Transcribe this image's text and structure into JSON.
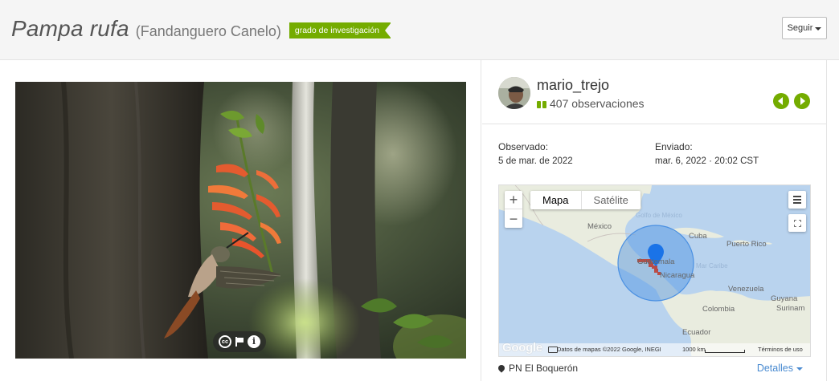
{
  "header": {
    "scientific_name": "Pampa rufa",
    "common_name": "(Fandanguero Canelo)",
    "quality_badge": "grado de investigación",
    "follow_label": "Seguir"
  },
  "photo": {
    "controls": [
      "cc-icon",
      "flag-icon",
      "info-icon"
    ],
    "cc_text": "cc"
  },
  "user": {
    "username": "mario_trejo",
    "observations": "407 observaciones"
  },
  "dates": {
    "observed_label": "Observado:",
    "observed_value": "5 de mar. de 2022",
    "submitted_label": "Enviado:",
    "submitted_value": "mar. 6, 2022 · 20:02 CST"
  },
  "map": {
    "type_options": [
      "Mapa",
      "Satélite"
    ],
    "selected_type": "Mapa",
    "labels": {
      "mexico": "México",
      "golfo": "Golfo de México",
      "cuba": "Cuba",
      "puerto_rico": "Puerto Rico",
      "guatemala": "Guatemala",
      "mar_caribe": "Mar Caribe",
      "nicaragua": "Nicaragua",
      "venezuela": "Venezuela",
      "guyana": "Guyana",
      "colombia": "Colombia",
      "surinam": "Surinam",
      "ecuador": "Ecuador"
    },
    "footer": {
      "google": "Google",
      "attribution": "Datos de mapas ©2022 Google, INEGI",
      "scale": "1000 km",
      "terms": "Términos de uso"
    },
    "colors": {
      "water": "#b9d3ee",
      "land": "#e9ecdf",
      "circle": "#4a90e2",
      "marker": "#1a73e8"
    }
  },
  "place": {
    "name": "PN El Boquerón",
    "details_label": "Detalles"
  },
  "colors": {
    "accent": "#74ac00",
    "link": "#4a8bd1"
  }
}
